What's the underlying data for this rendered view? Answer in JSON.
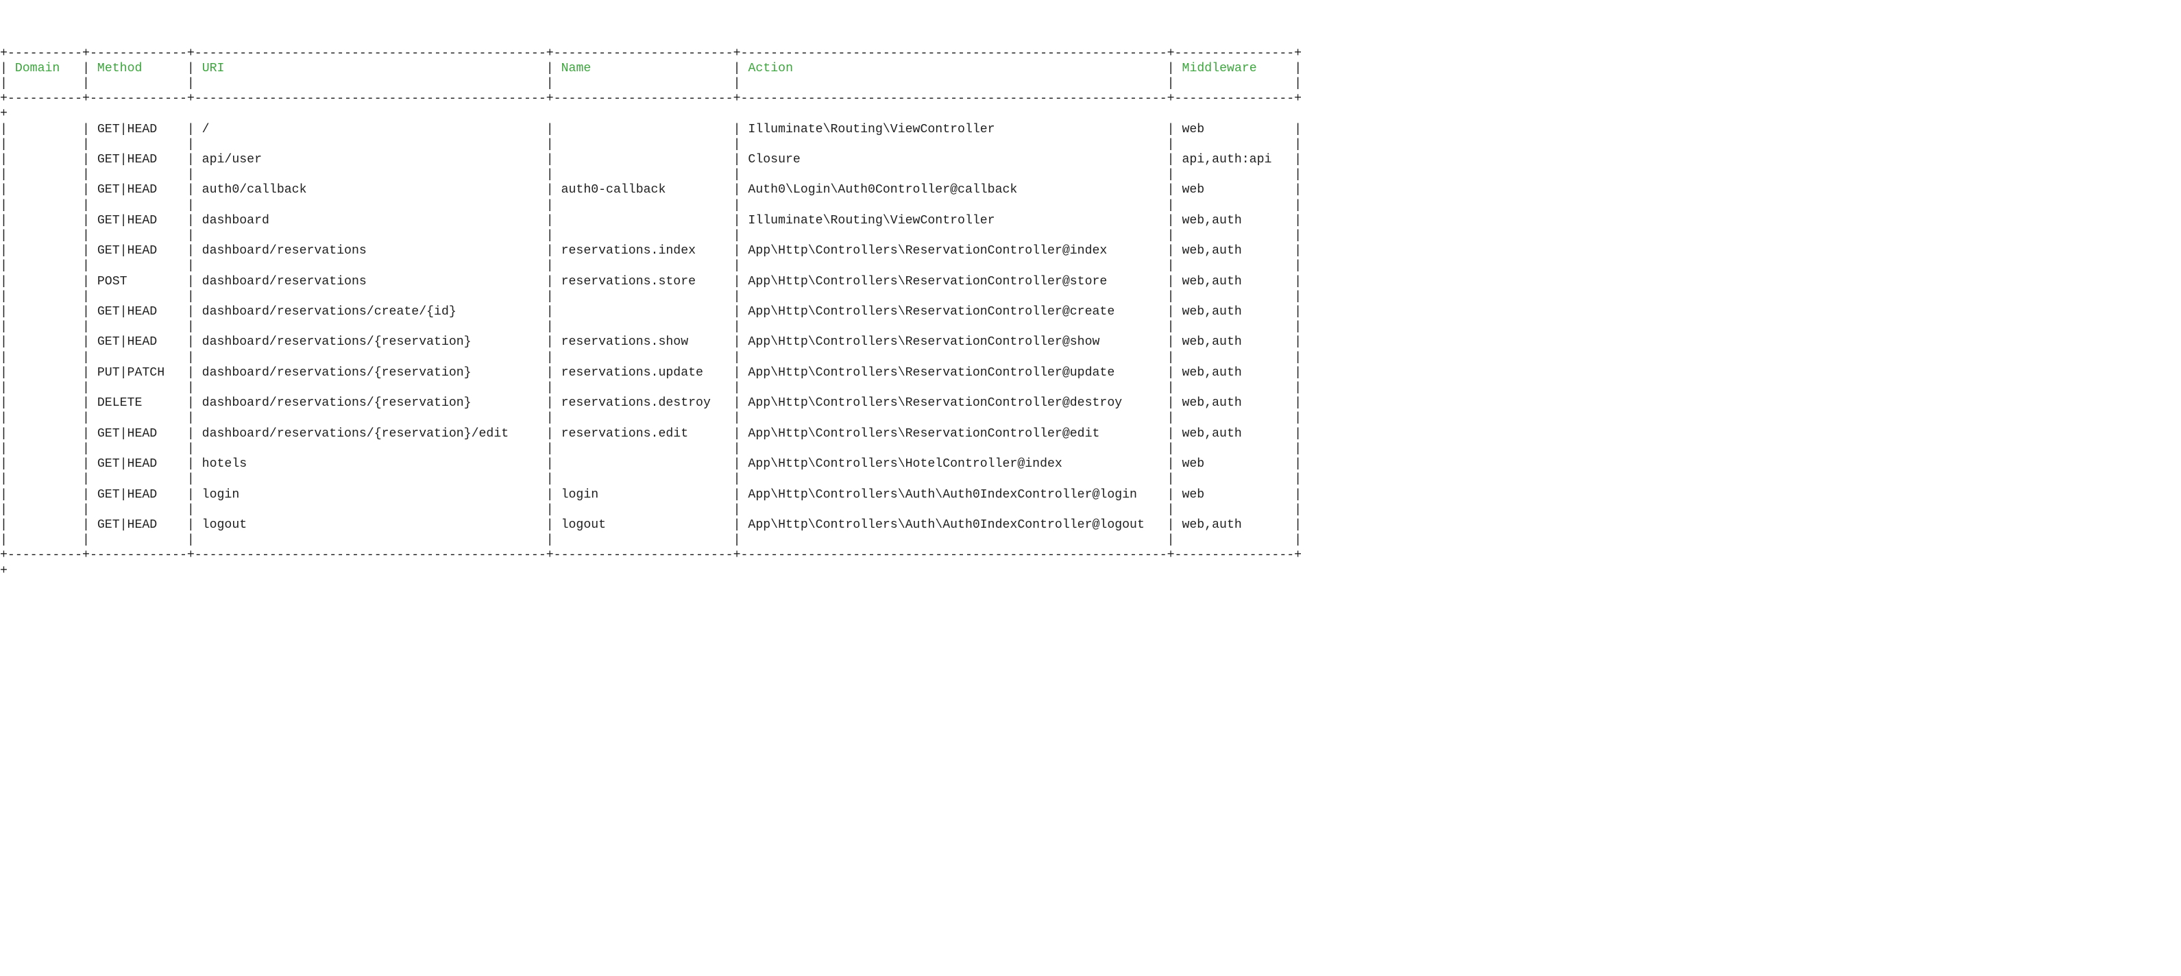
{
  "headers": {
    "domain": "Domain",
    "method": "Method",
    "uri": "URI",
    "name": "Name",
    "action": "Action",
    "middleware": "Middleware"
  },
  "columns": {
    "domain": 8,
    "method": 11,
    "uri": 45,
    "name": 22,
    "action": 55,
    "middleware": 14
  },
  "rows": [
    {
      "domain": "",
      "method": "GET|HEAD",
      "uri": "/",
      "name": "",
      "action": "Illuminate\\Routing\\ViewController",
      "middleware": "web"
    },
    {
      "domain": "",
      "method": "GET|HEAD",
      "uri": "api/user",
      "name": "",
      "action": "Closure",
      "middleware": "api,auth:api"
    },
    {
      "domain": "",
      "method": "GET|HEAD",
      "uri": "auth0/callback",
      "name": "auth0-callback",
      "action": "Auth0\\Login\\Auth0Controller@callback",
      "middleware": "web"
    },
    {
      "domain": "",
      "method": "GET|HEAD",
      "uri": "dashboard",
      "name": "",
      "action": "Illuminate\\Routing\\ViewController",
      "middleware": "web,auth"
    },
    {
      "domain": "",
      "method": "GET|HEAD",
      "uri": "dashboard/reservations",
      "name": "reservations.index",
      "action": "App\\Http\\Controllers\\ReservationController@index",
      "middleware": "web,auth"
    },
    {
      "domain": "",
      "method": "POST",
      "uri": "dashboard/reservations",
      "name": "reservations.store",
      "action": "App\\Http\\Controllers\\ReservationController@store",
      "middleware": "web,auth"
    },
    {
      "domain": "",
      "method": "GET|HEAD",
      "uri": "dashboard/reservations/create/{id}",
      "name": "",
      "action": "App\\Http\\Controllers\\ReservationController@create",
      "middleware": "web,auth"
    },
    {
      "domain": "",
      "method": "GET|HEAD",
      "uri": "dashboard/reservations/{reservation}",
      "name": "reservations.show",
      "action": "App\\Http\\Controllers\\ReservationController@show",
      "middleware": "web,auth"
    },
    {
      "domain": "",
      "method": "PUT|PATCH",
      "uri": "dashboard/reservations/{reservation}",
      "name": "reservations.update",
      "action": "App\\Http\\Controllers\\ReservationController@update",
      "middleware": "web,auth"
    },
    {
      "domain": "",
      "method": "DELETE",
      "uri": "dashboard/reservations/{reservation}",
      "name": "reservations.destroy",
      "action": "App\\Http\\Controllers\\ReservationController@destroy",
      "middleware": "web,auth"
    },
    {
      "domain": "",
      "method": "GET|HEAD",
      "uri": "dashboard/reservations/{reservation}/edit",
      "name": "reservations.edit",
      "action": "App\\Http\\Controllers\\ReservationController@edit",
      "middleware": "web,auth"
    },
    {
      "domain": "",
      "method": "GET|HEAD",
      "uri": "hotels",
      "name": "",
      "action": "App\\Http\\Controllers\\HotelController@index",
      "middleware": "web"
    },
    {
      "domain": "",
      "method": "GET|HEAD",
      "uri": "login",
      "name": "login",
      "action": "App\\Http\\Controllers\\Auth\\Auth0IndexController@login",
      "middleware": "web"
    },
    {
      "domain": "",
      "method": "GET|HEAD",
      "uri": "logout",
      "name": "logout",
      "action": "App\\Http\\Controllers\\Auth\\Auth0IndexController@logout",
      "middleware": "web,auth"
    }
  ]
}
